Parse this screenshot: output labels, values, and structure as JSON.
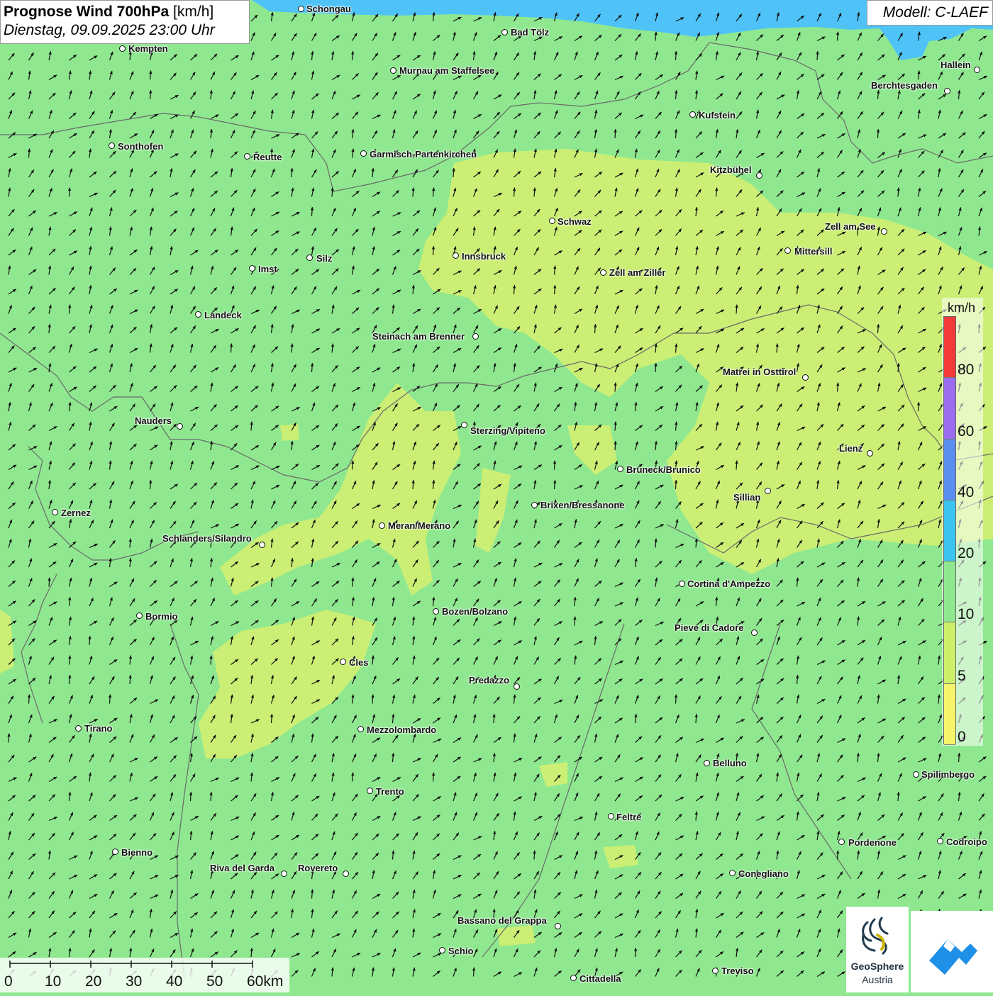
{
  "title": {
    "bold": "Prognose Wind 700hPa",
    "unit": " [km/h]",
    "datetime": "Dienstag, 09.09.2025 23:00 Uhr"
  },
  "model": "Modell: C-LAEF",
  "colors": {
    "background_green": "#8fe88f",
    "light_green": "#c8f07a",
    "yellow_green": "#d8f070",
    "water": "#4fc3f7",
    "border": "#6a6a6a"
  },
  "legend": {
    "unit": "km/h",
    "bands": [
      {
        "label": "80",
        "color": "#f23a3a"
      },
      {
        "label": "60",
        "color": "#9b6bf0"
      },
      {
        "label": "40",
        "color": "#5b8ef0"
      },
      {
        "label": "20",
        "color": "#3cc4f0"
      },
      {
        "label": "10",
        "color": "#8fe88f"
      },
      {
        "label": "5",
        "color": "#cdf06a"
      },
      {
        "label": "0",
        "color": "#f6f46a"
      }
    ]
  },
  "scale_bar": {
    "labels": [
      "0",
      "10",
      "20",
      "30",
      "40",
      "50",
      "60km"
    ]
  },
  "logo": {
    "name": "GeoSphere",
    "sub": "Austria",
    "icon": "geosphere-logo-icon",
    "partner_icon": "blue-mountain-logo-icon"
  },
  "cities": [
    {
      "name": "Schongau"
    },
    {
      "name": "Bad Tölz"
    },
    {
      "name": "Kempten"
    },
    {
      "name": "Murnau am Staffelsee"
    },
    {
      "name": "Hallein"
    },
    {
      "name": "Berchtesgaden"
    },
    {
      "name": "Kufstein"
    },
    {
      "name": "Sonthofen"
    },
    {
      "name": "Reutte"
    },
    {
      "name": "Garmisch-Partenkirchen"
    },
    {
      "name": "Kitzbühel"
    },
    {
      "name": "Schwaz"
    },
    {
      "name": "Zell am See"
    },
    {
      "name": "Mittersill"
    },
    {
      "name": "Innsbruck"
    },
    {
      "name": "Silz"
    },
    {
      "name": "Imst"
    },
    {
      "name": "Zell am Ziller"
    },
    {
      "name": "Landeck"
    },
    {
      "name": "Steinach am Brenner"
    },
    {
      "name": "Matrei in Osttirol"
    },
    {
      "name": "Nauders"
    },
    {
      "name": "Sterzing/Vipiteno"
    },
    {
      "name": "Lienz"
    },
    {
      "name": "Bruneck/Brunico"
    },
    {
      "name": "Sillian"
    },
    {
      "name": "Zernez"
    },
    {
      "name": "Brixen/Bressanone"
    },
    {
      "name": "Meran/Merano"
    },
    {
      "name": "Schlanders/Silandro"
    },
    {
      "name": "Cortina d'Ampezzo"
    },
    {
      "name": "Bormio"
    },
    {
      "name": "Bozen/Bolzano"
    },
    {
      "name": "Pieve di Cadore"
    },
    {
      "name": "Cles"
    },
    {
      "name": "Predazzo"
    },
    {
      "name": "Tirano"
    },
    {
      "name": "Mezzolombardo"
    },
    {
      "name": "Belluno"
    },
    {
      "name": "Spilimbergo"
    },
    {
      "name": "Trento"
    },
    {
      "name": "Feltre"
    },
    {
      "name": "Pordenone"
    },
    {
      "name": "Codroipo"
    },
    {
      "name": "Bienno"
    },
    {
      "name": "Riva del Garda"
    },
    {
      "name": "Rovereto"
    },
    {
      "name": "Conegliano"
    },
    {
      "name": "Bassano del Grappa"
    },
    {
      "name": "Schio"
    },
    {
      "name": "Treviso"
    },
    {
      "name": "Cittadella"
    }
  ],
  "wind_field": {
    "dominant_direction": "north-east",
    "arrow_icon": "wind-arrow-icon"
  }
}
